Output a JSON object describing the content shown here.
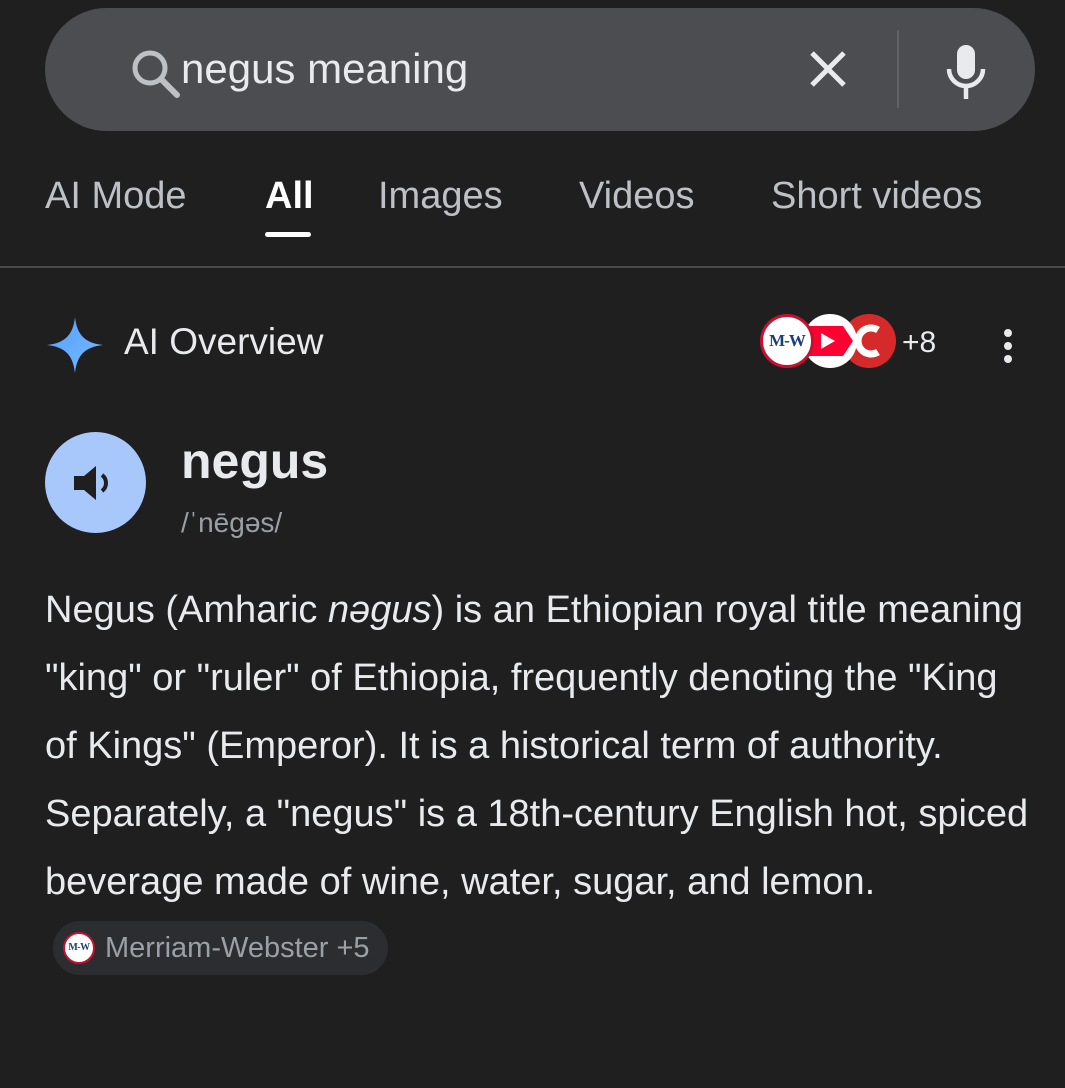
{
  "search": {
    "query": "negus meaning"
  },
  "tabs": [
    {
      "label": "AI Mode"
    },
    {
      "label": "All"
    },
    {
      "label": "Images"
    },
    {
      "label": "Videos"
    },
    {
      "label": "Short videos"
    }
  ],
  "active_tab": "All",
  "ai_overview": {
    "title": "AI Overview",
    "source_logo_text": "M-W",
    "source_count": "+8"
  },
  "entry": {
    "word": "negus",
    "pronunciation": "/ˈnēɡəs/"
  },
  "definition": {
    "part1": "Negus (Amharic ",
    "italic": "nəgus",
    "part2": ") is an Ethiopian royal title meaning \"king\" or \"ruler\" of Ethiopia, frequently denoting the \"King of Kings\" (Emperor). It is a historical term of authority. Separately, a \"negus\" is a 18th-century English hot, spiced beverage made of wine, water, sugar, and lemon.",
    "citation": "Merriam-Webster +5"
  },
  "colors": {
    "background": "#1f1f1f",
    "search_bar": "#4b4d51",
    "accent_blue": "#a8c7fa",
    "mw_red": "#c8102e",
    "youtube_red": "#ff0033"
  },
  "icons": [
    "search-icon",
    "close-icon",
    "mic-icon",
    "sparkle-icon",
    "more-vert-icon",
    "speaker-icon",
    "merriam-webster-logo",
    "youtube-logo",
    "collins-logo"
  ]
}
